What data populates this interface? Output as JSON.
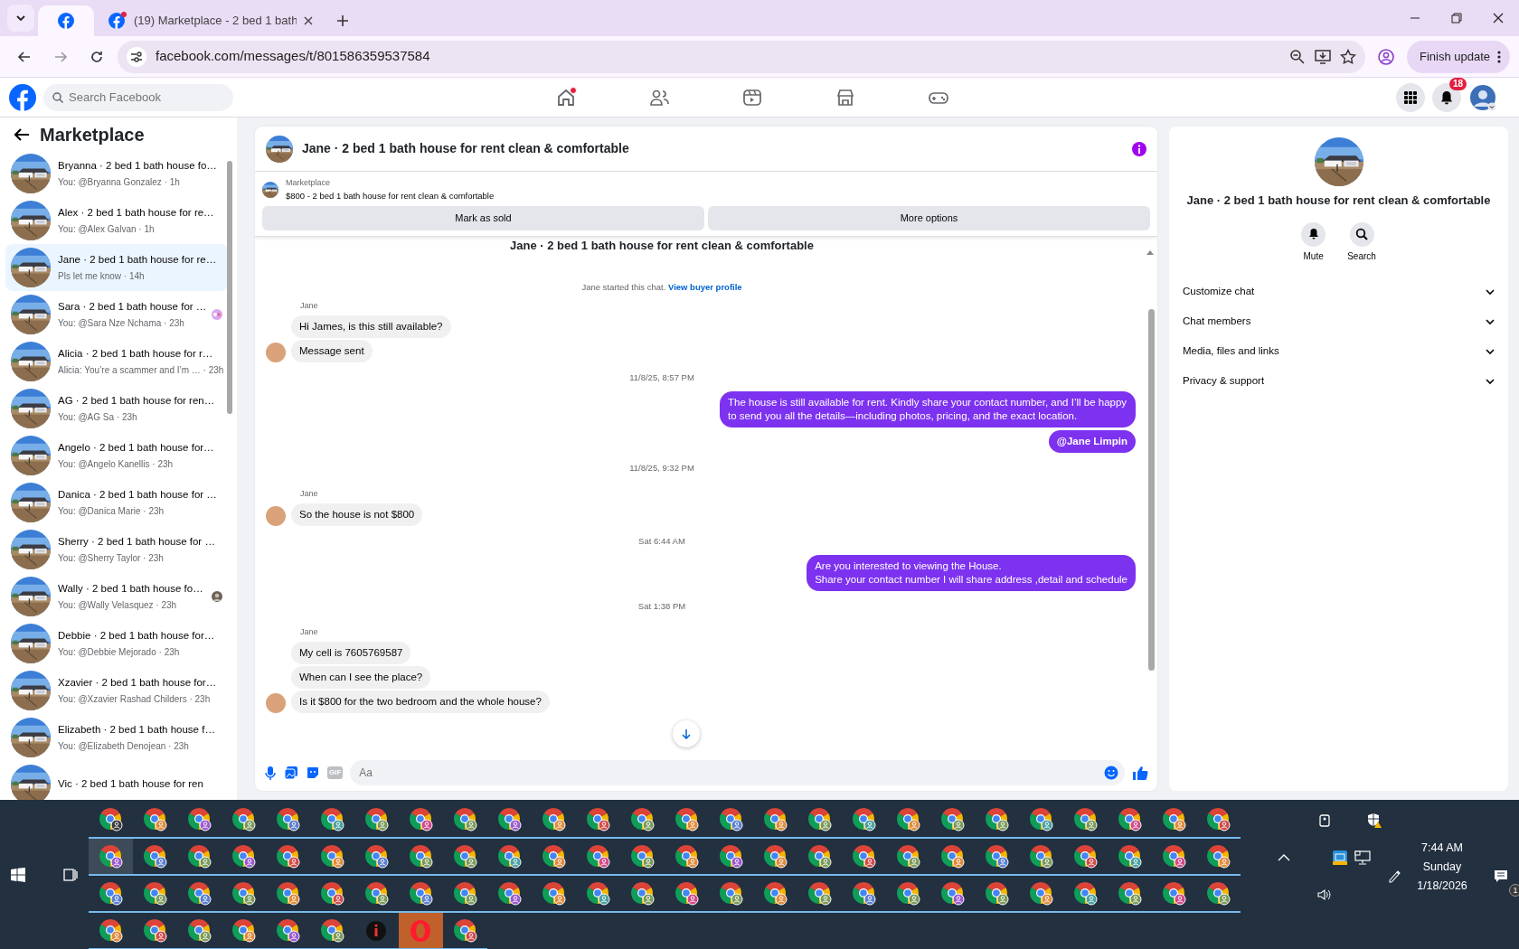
{
  "browser": {
    "tabs": [
      {
        "selected": true
      },
      {
        "title": "(19) Marketplace - 2 bed 1 bath",
        "selected": false
      }
    ],
    "address": "facebook.com/messages/t/801586359537584",
    "update_button": "Finish update"
  },
  "facebook_header": {
    "search": {
      "placeholder": "Search Facebook"
    },
    "nav": [
      {
        "kind": "home",
        "dot": true
      },
      {
        "kind": "friends",
        "dot": false
      },
      {
        "kind": "video",
        "dot": false
      },
      {
        "kind": "marketplace",
        "dot": false
      },
      {
        "kind": "gaming",
        "dot": false
      }
    ],
    "notifications_badge": "18"
  },
  "sidebar": {
    "title": "Marketplace",
    "conversations": [
      {
        "title": "Bryanna · 2 bed 1 bath house fo…",
        "snippet": "You: @Bryanna Gonzalez · 1h",
        "selected": false,
        "kind": "plain"
      },
      {
        "title": "Alex · 2 bed 1 bath house for re…",
        "snippet": "You: @Alex Galvan · 1h",
        "selected": false,
        "kind": "plain"
      },
      {
        "title": "Jane · 2 bed 1 bath house for re…",
        "snippet": "Pls let me know · 14h",
        "selected": true,
        "kind": "plain"
      },
      {
        "title": "Sara · 2 bed 1 bath house for …",
        "snippet": "You: @Sara Nze Nchama · 23h",
        "selected": false,
        "kind": "sticker"
      },
      {
        "title": "Alicia · 2 bed 1 bath house for r…",
        "snippet": "Alicia: You’re a scammer and I’m … · 23h",
        "selected": false,
        "kind": "plain"
      },
      {
        "title": "AG · 2 bed 1 bath house for ren…",
        "snippet": "You: @AG Sa · 23h",
        "selected": false,
        "kind": "plain"
      },
      {
        "title": "Angelo · 2 bed 1 bath house for…",
        "snippet": "You: @Angelo Kanellis · 23h",
        "selected": false,
        "kind": "plain"
      },
      {
        "title": "Danica · 2 bed 1 bath house for …",
        "snippet": "You: @Danica Marie · 23h",
        "selected": false,
        "kind": "plain"
      },
      {
        "title": "Sherry · 2 bed 1 bath house for …",
        "snippet": "You: @Sherry Taylor · 23h",
        "selected": false,
        "kind": "plain"
      },
      {
        "title": "Wally · 2 bed 1 bath house fo…",
        "snippet": "You: @Wally Velasquez · 23h",
        "selected": false,
        "kind": "seen"
      },
      {
        "title": "Debbie · 2 bed 1 bath house for…",
        "snippet": "You: @Debbie Mejorado · 23h",
        "selected": false,
        "kind": "plain"
      },
      {
        "title": "Xzavier · 2 bed 1 bath house for…",
        "snippet": "You: @Xzavier Rashad Childers · 23h",
        "selected": false,
        "kind": "plain"
      },
      {
        "title": "Elizabeth · 2 bed 1 bath house f…",
        "snippet": "You: @Elizabeth Denojean · 23h",
        "selected": false,
        "kind": "plain"
      },
      {
        "title": "Vic · 2 bed 1 bath house for ren",
        "selected": false,
        "kind": "plain"
      }
    ]
  },
  "chat": {
    "title": "Jane · 2 bed 1 bath house for rent clean & comfortable",
    "listing": {
      "label": "Marketplace",
      "description": "$800 - 2 bed 1 bath house for rent clean & comfortable",
      "buttons": [
        "Mark as sold",
        "More options"
      ]
    },
    "messages": [
      {
        "kind": "heading",
        "text": "Jane · 2 bed 1 bath house for rent clean & comfortable"
      },
      {
        "kind": "system",
        "text": "Jane started this chat.",
        "link": "View buyer profile"
      },
      {
        "kind": "incoming",
        "sender": "Jane",
        "bubbles": [
          {
            "text": "Hi James, is this still available?",
            "mention": false
          },
          {
            "text": "Message sent",
            "mention": false
          }
        ]
      },
      {
        "kind": "timestamp",
        "text": "11/8/25, 8:57 PM"
      },
      {
        "kind": "outgoing",
        "bubbles": [
          {
            "text": "The house is still available for rent. Kindly share your contact number, and I’ll be happy to send you all the details—including photos, pricing, and the exact location.",
            "mention": false
          },
          {
            "text": "@Jane Limpin",
            "mention": true
          }
        ]
      },
      {
        "kind": "timestamp",
        "text": "11/8/25, 9:32 PM"
      },
      {
        "kind": "incoming",
        "sender": "Jane",
        "bubbles": [
          {
            "text": "So the house is not $800",
            "mention": false
          }
        ]
      },
      {
        "kind": "timestamp",
        "text": "Sat 6:44 AM"
      },
      {
        "kind": "outgoing",
        "bubbles": [
          {
            "text": "Are you interested to viewing  the House.\nShare your contact number I will share address ,detail and schedule",
            "mention": false
          }
        ]
      },
      {
        "kind": "timestamp",
        "text": "Sat 1:38 PM"
      },
      {
        "kind": "incoming",
        "sender": "Jane",
        "bubbles": [
          {
            "text": "My cell is 7605769587",
            "mention": false
          },
          {
            "text": "When can I see the place?",
            "mention": false
          },
          {
            "text": "Is it $800 for the two bedroom and the whole house?",
            "mention": false
          }
        ]
      }
    ],
    "composer": {
      "gif_label": "GIF",
      "placeholder": "Aa"
    }
  },
  "details": {
    "title": "Jane · 2 bed 1 bath house for rent clean & comfortable",
    "actions": [
      {
        "kind": "mute",
        "label": "Mute"
      },
      {
        "kind": "search",
        "label": "Search"
      }
    ],
    "sections": [
      {
        "label": "Customize chat",
        "expanded": false
      },
      {
        "label": "Chat members",
        "expanded": false
      },
      {
        "label": "Media, files and links",
        "expanded": false
      },
      {
        "label": "Privacy & support",
        "expanded": false
      }
    ]
  },
  "taskbar": {
    "apps": [
      {
        "kind": "browser",
        "color": "#3a3a3a",
        "selected": false
      },
      {
        "kind": "browser",
        "color": "#e08a3c",
        "selected": false
      },
      {
        "kind": "browser",
        "color": "#9b59d0",
        "selected": false
      },
      {
        "kind": "browser",
        "color": "#7a9a5a",
        "selected": false
      },
      {
        "kind": "browser",
        "color": "#5b7fd0",
        "selected": false
      },
      {
        "kind": "browser",
        "color": "#4aa0a0",
        "selected": false
      },
      {
        "kind": "browser",
        "color": "#7a9a5a",
        "selected": false
      },
      {
        "kind": "browser",
        "color": "#d04a8a",
        "selected": false
      },
      {
        "kind": "browser",
        "color": "#7a9a5a",
        "selected": false
      },
      {
        "kind": "browser",
        "color": "#9b59d0",
        "selected": false
      },
      {
        "kind": "browser",
        "color": "#e08a3c",
        "selected": false
      },
      {
        "kind": "browser",
        "color": "#d04a4a",
        "selected": false
      },
      {
        "kind": "browser",
        "color": "#7a9a5a",
        "selected": false
      },
      {
        "kind": "browser",
        "color": "#e08a3c",
        "selected": false
      },
      {
        "kind": "browser",
        "color": "#5b7fd0",
        "selected": false
      },
      {
        "kind": "browser",
        "color": "#e08a3c",
        "selected": false
      },
      {
        "kind": "browser",
        "color": "#7a9a5a",
        "selected": false
      },
      {
        "kind": "browser",
        "color": "#4aa0a0",
        "selected": false
      },
      {
        "kind": "browser",
        "color": "#e08a3c",
        "selected": false
      },
      {
        "kind": "browser",
        "color": "#7a9a5a",
        "selected": false
      },
      {
        "kind": "browser",
        "color": "#7a9a5a",
        "selected": false
      },
      {
        "kind": "browser",
        "color": "#4aa0a0",
        "selected": false
      },
      {
        "kind": "browser",
        "color": "#7a9a5a",
        "selected": false
      },
      {
        "kind": "browser",
        "color": "#d04a8a",
        "selected": false
      },
      {
        "kind": "browser",
        "color": "#e08a3c",
        "selected": false
      },
      {
        "kind": "browser",
        "color": "#d04a4a",
        "selected": false
      },
      {
        "kind": "browser",
        "color": "#9b59d0",
        "selected": true
      },
      {
        "kind": "browser",
        "color": "#5b7fd0",
        "selected": false
      },
      {
        "kind": "browser",
        "color": "#7a9a5a",
        "selected": false
      },
      {
        "kind": "browser",
        "color": "#9b59d0",
        "selected": false
      },
      {
        "kind": "browser",
        "color": "#d04a4a",
        "selected": false
      },
      {
        "kind": "browser",
        "color": "#e08a3c",
        "selected": false
      },
      {
        "kind": "browser",
        "color": "#5b7fd0",
        "selected": false
      },
      {
        "kind": "browser",
        "color": "#7a9a5a",
        "selected": false
      },
      {
        "kind": "browser",
        "color": "#7a9a5a",
        "selected": false
      },
      {
        "kind": "browser",
        "color": "#4aa0a0",
        "selected": false
      },
      {
        "kind": "browser",
        "color": "#e08a3c",
        "selected": false
      },
      {
        "kind": "browser",
        "color": "#d04a8a",
        "selected": false
      },
      {
        "kind": "browser",
        "color": "#7a9a5a",
        "selected": false
      },
      {
        "kind": "browser",
        "color": "#e08a3c",
        "selected": false
      },
      {
        "kind": "browser",
        "color": "#9b59d0",
        "selected": false
      },
      {
        "kind": "browser",
        "color": "#e08a3c",
        "selected": false
      },
      {
        "kind": "browser",
        "color": "#7a9a5a",
        "selected": false
      },
      {
        "kind": "browser",
        "color": "#d04a4a",
        "selected": false
      },
      {
        "kind": "browser",
        "color": "#7a9a5a",
        "selected": false
      },
      {
        "kind": "browser",
        "color": "#e08a3c",
        "selected": false
      },
      {
        "kind": "browser",
        "color": "#5b7fd0",
        "selected": false
      },
      {
        "kind": "browser",
        "color": "#7a9a5a",
        "selected": false
      },
      {
        "kind": "browser",
        "color": "#d04a4a",
        "selected": false
      },
      {
        "kind": "browser",
        "color": "#4aa0a0",
        "selected": false
      },
      {
        "kind": "browser",
        "color": "#d04a8a",
        "selected": false
      },
      {
        "kind": "browser",
        "color": "#e08a3c",
        "selected": false
      },
      {
        "kind": "browser",
        "color": "#5b7fd0",
        "selected": false
      },
      {
        "kind": "browser",
        "color": "#7a9a5a",
        "selected": false
      },
      {
        "kind": "browser",
        "color": "#5b7fd0",
        "selected": false
      },
      {
        "kind": "browser",
        "color": "#7a9a5a",
        "selected": false
      },
      {
        "kind": "browser",
        "color": "#e08a3c",
        "selected": false
      },
      {
        "kind": "browser",
        "color": "#d04a4a",
        "selected": false
      },
      {
        "kind": "browser",
        "color": "#7a9a5a",
        "selected": false
      },
      {
        "kind": "browser",
        "color": "#5b7fd0",
        "selected": false
      },
      {
        "kind": "browser",
        "color": "#7a9a5a",
        "selected": false
      },
      {
        "kind": "browser",
        "color": "#9b59d0",
        "selected": false
      },
      {
        "kind": "browser",
        "color": "#e08a3c",
        "selected": false
      },
      {
        "kind": "browser",
        "color": "#4aa0a0",
        "selected": false
      },
      {
        "kind": "browser",
        "color": "#7a9a5a",
        "selected": false
      },
      {
        "kind": "browser",
        "color": "#d04a8a",
        "selected": false
      },
      {
        "kind": "browser",
        "color": "#7a9a5a",
        "selected": false
      },
      {
        "kind": "browser",
        "color": "#e08a3c",
        "selected": false
      },
      {
        "kind": "browser",
        "color": "#7a9a5a",
        "selected": false
      },
      {
        "kind": "browser",
        "color": "#5b7fd0",
        "selected": false
      },
      {
        "kind": "browser",
        "color": "#7a9a5a",
        "selected": false
      },
      {
        "kind": "browser",
        "color": "#9b59d0",
        "selected": false
      },
      {
        "kind": "browser",
        "color": "#7a9a5a",
        "selected": false
      },
      {
        "kind": "browser",
        "color": "#e08a3c",
        "selected": false
      },
      {
        "kind": "browser",
        "color": "#4aa0a0",
        "selected": false
      },
      {
        "kind": "browser",
        "color": "#7a9a5a",
        "selected": false
      },
      {
        "kind": "browser",
        "color": "#d04a8a",
        "selected": false
      },
      {
        "kind": "browser",
        "color": "#7a9a5a",
        "selected": false
      },
      {
        "kind": "browser",
        "color": "#e08a3c",
        "selected": false
      },
      {
        "kind": "browser",
        "color": "#d04a4a",
        "selected": false
      },
      {
        "kind": "browser",
        "color": "#7a9a5a",
        "selected": false
      },
      {
        "kind": "browser",
        "color": "#e08a3c",
        "selected": false
      },
      {
        "kind": "browser",
        "color": "#9b59d0",
        "selected": false
      },
      {
        "kind": "browser",
        "color": "#7a9a5a",
        "selected": false
      },
      {
        "kind": "dark",
        "selected": false
      },
      {
        "kind": "opera",
        "selected": true
      },
      {
        "kind": "browser",
        "color": "#d04a4a",
        "selected": false
      }
    ],
    "clock": {
      "time": "7:44 AM",
      "day": "Sunday",
      "date": "1/18/2026"
    },
    "notifications_badge": "1"
  }
}
